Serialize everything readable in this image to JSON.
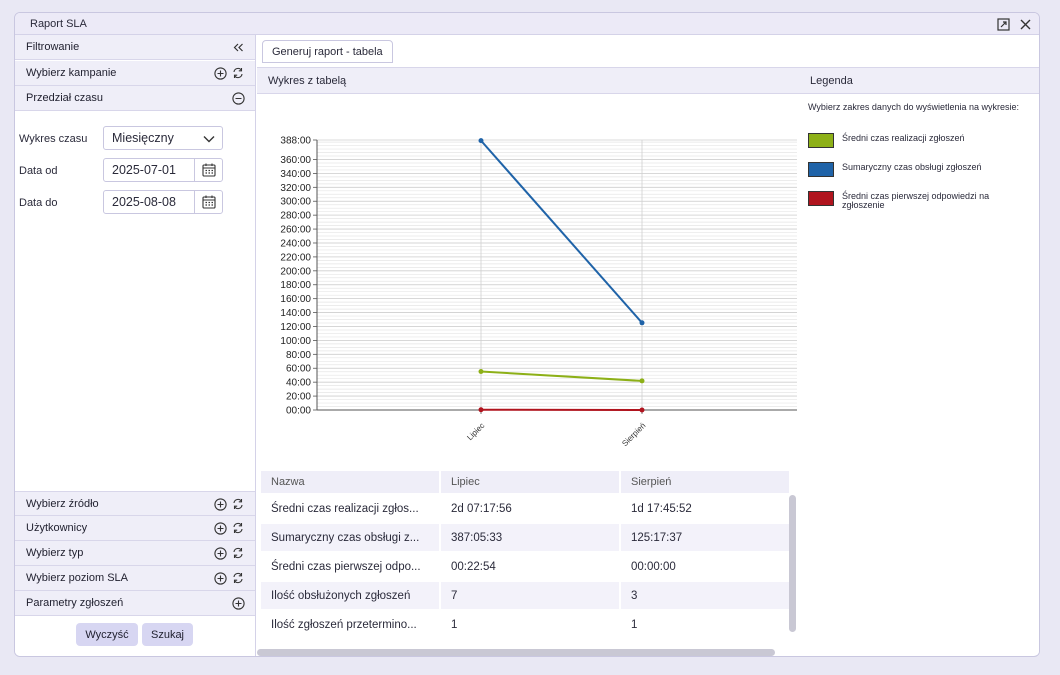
{
  "window": {
    "title": "Raport SLA"
  },
  "left_panel": {
    "filter_title": "Filtrowanie",
    "campaign_label": "Wybierz kampanie",
    "time_range_label": "Przedział czasu",
    "chart_time_label": "Wykres czasu",
    "chart_time_value": "Miesięczny",
    "date_from_label": "Data od",
    "date_from_value": "2025-07-01",
    "date_to_label": "Data do",
    "date_to_value": "2025-08-08",
    "source_label": "Wybierz źródło",
    "users_label": "Użytkownicy",
    "type_label": "Wybierz typ",
    "sla_level_label": "Wybierz poziom SLA",
    "params_label": "Parametry zgłoszeń",
    "clear_button": "Wyczyść",
    "search_button": "Szukaj"
  },
  "tabs": [
    {
      "label": "Generuj raport - tabela"
    }
  ],
  "chart_panel": {
    "title": "Wykres z tabelą"
  },
  "legend": {
    "title": "Legenda",
    "description": "Wybierz zakres danych do wyświetlenia na wykresie:",
    "items": [
      {
        "label": "Średni czas realizacji zgłoszeń",
        "color": "#8db017"
      },
      {
        "label": "Sumaryczny czas obsługi zgłoszeń",
        "color": "#1f63a8"
      },
      {
        "label": "Średni czas pierwszej odpowiedzi na zgłoszenie",
        "color": "#b0141e"
      }
    ]
  },
  "chart_data": {
    "type": "line",
    "categories": [
      "Lipiec",
      "Sierpień"
    ],
    "y_ticks": [
      "00:00",
      "20:00",
      "40:00",
      "60:00",
      "80:00",
      "100:00",
      "120:00",
      "140:00",
      "160:00",
      "180:00",
      "200:00",
      "220:00",
      "240:00",
      "260:00",
      "280:00",
      "300:00",
      "320:00",
      "340:00",
      "360:00",
      "388:00"
    ],
    "ylim": [
      0,
      388
    ],
    "grid": true,
    "series": [
      {
        "name": "Średni czas realizacji zgłoszeń",
        "color": "#8db017",
        "values": [
          55.3,
          41.8
        ]
      },
      {
        "name": "Sumaryczny czas obsługi zgłoszeń",
        "color": "#1f63a8",
        "values": [
          387.1,
          125.3
        ]
      },
      {
        "name": "Średni czas pierwszej odpowiedzi na zgłoszenie",
        "color": "#b0141e",
        "values": [
          0.4,
          0.0
        ]
      }
    ]
  },
  "table": {
    "headers": [
      "Nazwa",
      "Lipiec",
      "Sierpień"
    ],
    "rows": [
      [
        "Średni czas realizacji zgłos...",
        "2d 07:17:56",
        "1d 17:45:52"
      ],
      [
        "Sumaryczny czas obsługi z...",
        "387:05:33",
        "125:17:37"
      ],
      [
        "Średni czas pierwszej odpo...",
        "00:22:54",
        "00:00:00"
      ],
      [
        "Ilość obsłużonych zgłoszeń",
        "7",
        "3"
      ],
      [
        "Ilość zgłoszeń przetermino...",
        "1",
        "1"
      ]
    ]
  }
}
